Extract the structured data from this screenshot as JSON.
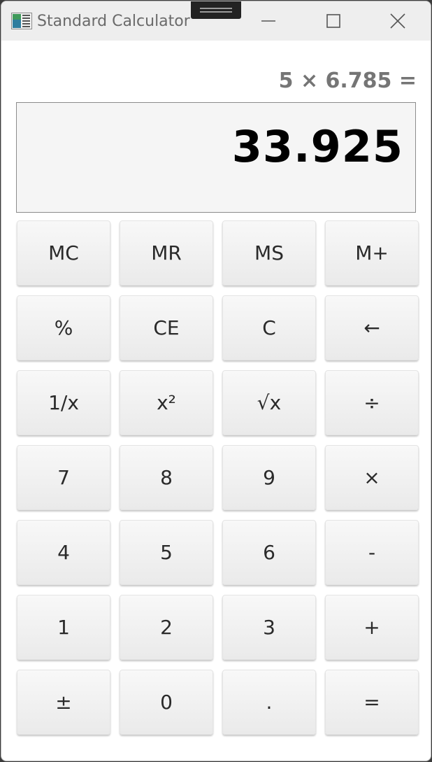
{
  "window": {
    "title": "Standard Calculator"
  },
  "titlebar": {
    "minimize_icon": "minimize-icon",
    "maximize_icon": "maximize-icon",
    "close_icon": "close-icon",
    "app_icon": "calculator-app-icon"
  },
  "display": {
    "expression": "5 × 6.785 =",
    "value": "33.925"
  },
  "keypad": {
    "rows": [
      [
        "MC",
        "MR",
        "MS",
        "M+"
      ],
      [
        "%",
        "CE",
        "C",
        "←"
      ],
      [
        "1/x",
        "x²",
        "√x",
        "÷"
      ],
      [
        "7",
        "8",
        "9",
        "×"
      ],
      [
        "4",
        "5",
        "6",
        "-"
      ],
      [
        "1",
        "2",
        "3",
        "+"
      ],
      [
        "±",
        "0",
        ".",
        "="
      ]
    ]
  },
  "colors": {
    "titlebar_bg": "#eeeeee",
    "window_bg": "#ffffff",
    "display_bg": "#f5f5f5",
    "expression_text": "#757575",
    "value_text": "#000000",
    "key_text": "#2a2a2a"
  }
}
